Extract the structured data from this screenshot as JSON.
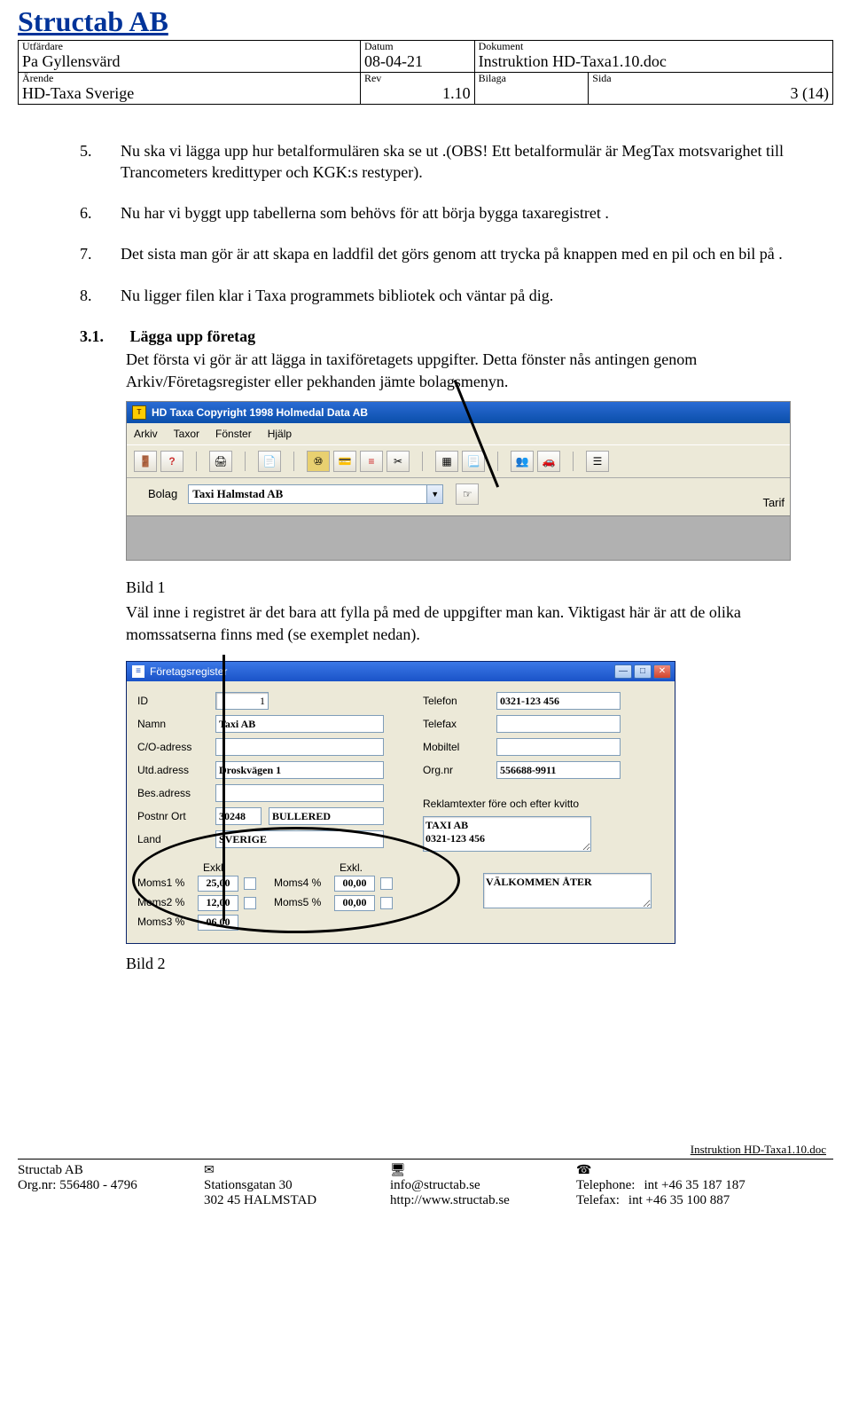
{
  "header": {
    "company": "Structab AB",
    "labels": {
      "utf": "Utfärdare",
      "datum": "Datum",
      "dokument": "Dokument",
      "arende": "Ärende",
      "rev": "Rev",
      "bilaga": "Bilaga",
      "sida": "Sida"
    },
    "utf": "Pa Gyllensvärd",
    "datum": "08-04-21",
    "dokument": "Instruktion HD-Taxa1.10.doc",
    "arende": "HD-Taxa Sverige",
    "rev": "1.10",
    "bilaga": "",
    "sida": "3 (14)"
  },
  "items": {
    "i5": {
      "num": "5.",
      "text": "Nu ska vi lägga upp hur betalformulären ska se ut .(OBS! Ett betalformulär är MegTax motsvarighet till Trancometers kredittyper och KGK:s restyper)."
    },
    "i6": {
      "num": "6.",
      "text": "Nu har vi byggt upp tabellerna som behövs för att börja bygga taxaregistret ."
    },
    "i7": {
      "num": "7.",
      "text": "Det sista man gör är att skapa en laddfil det görs genom att trycka på knappen med en pil och en bil på ."
    },
    "i8": {
      "num": "8.",
      "text": "Nu ligger filen klar i Taxa programmets bibliotek och väntar på dig."
    }
  },
  "section": {
    "num": "3.1.",
    "title": "Lägga upp företag",
    "body": "Det första vi gör är att lägga in taxiföretagets uppgifter. Detta fönster nås antingen genom Arkiv/Företagsregister eller pekhanden jämte bolagsmenyn."
  },
  "shot1": {
    "title": "HD Taxa Copyright 1998 Holmedal Data AB",
    "menu": [
      "Arkiv",
      "Taxor",
      "Fönster",
      "Hjälp"
    ],
    "bolag_label": "Bolag",
    "bolag_value": "Taxi Halmstad AB",
    "tarif_label": "Tarif"
  },
  "bild1_cap": "Bild 1",
  "bild1_text": "Väl inne i registret är det bara att fylla på med de uppgifter man kan. Viktigast här är att de olika momssatserna finns med (se exemplet nedan).",
  "shot2": {
    "title": "Företagsregister",
    "labels": {
      "id": "ID",
      "namn": "Namn",
      "co": "C/O-adress",
      "utd": "Utd.adress",
      "bes": "Bes.adress",
      "postnr": "Postnr Ort",
      "land": "Land",
      "tel": "Telefon",
      "fax": "Telefax",
      "mob": "Mobiltel",
      "org": "Org.nr",
      "reklam": "Reklamtexter före och efter kvitto",
      "exkl": "Exkl.",
      "m1": "Moms1 %",
      "m2": "Moms2 %",
      "m3": "Moms3 %",
      "m4": "Moms4 %",
      "m5": "Moms5 %"
    },
    "id": "1",
    "namn": "Taxi AB",
    "co": "",
    "utd": "Droskvägen 1",
    "bes": "",
    "postnr": "30248",
    "ort": "BULLERED",
    "land": "SVERIGE",
    "tel": "0321-123 456",
    "fax": "",
    "mob": "",
    "org": "556688-9911",
    "reklam1": "TAXI AB\n0321-123 456",
    "reklam2": "VÄLKOMMEN ÅTER",
    "moms1": "25,00",
    "moms2": "12,00",
    "moms3": "06,00",
    "moms4": "00,00",
    "moms5": "00,00"
  },
  "bild2_cap": "Bild 2",
  "footer": {
    "docname": "Instruktion HD-Taxa1.10.doc",
    "col1a": "Structab AB",
    "col1b": "Org.nr: 556480 - 4796",
    "col2a": "Stationsgatan 30",
    "col2b": "302 45 HALMSTAD",
    "col3a": "info@structab.se",
    "col3b": "http://www.structab.se",
    "tel_lbl": "Telephone:",
    "fax_lbl": "Telefax:",
    "tel": "int +46 35 187 187",
    "fax": "int +46 35 100 887"
  }
}
